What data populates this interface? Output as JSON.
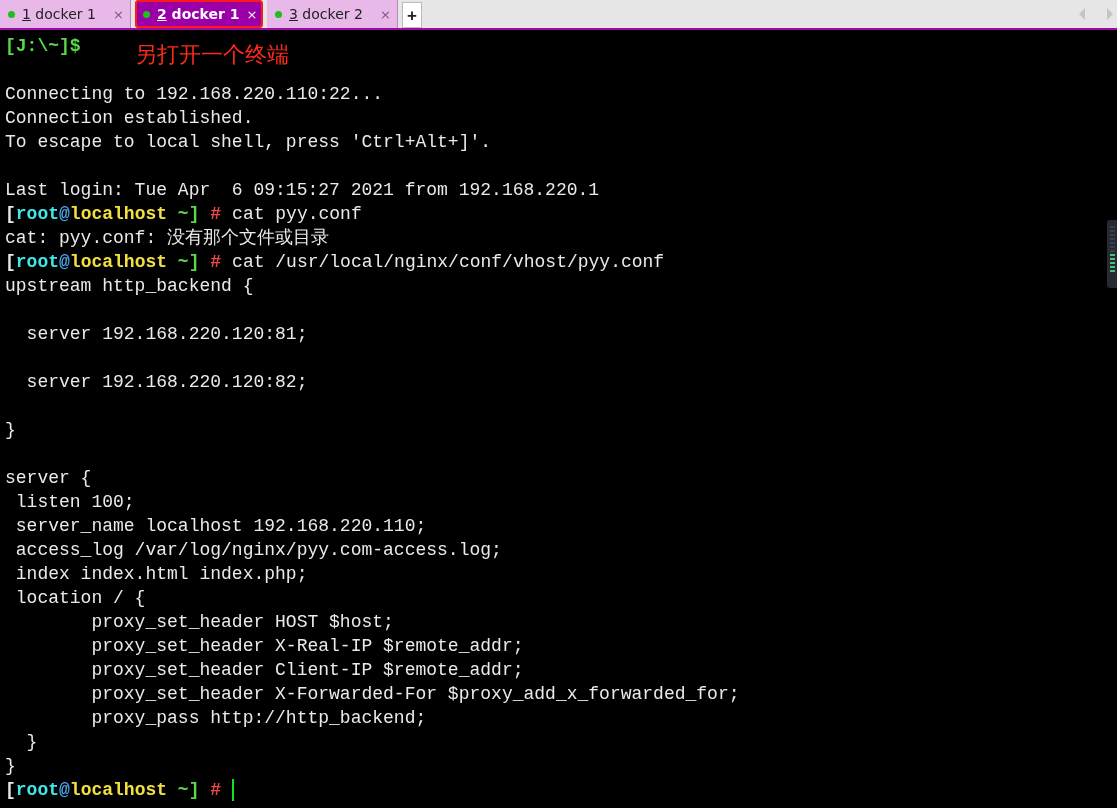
{
  "tabs": [
    {
      "number": "1",
      "label": "docker 1",
      "close": "×",
      "selected": false
    },
    {
      "number": "2",
      "label": "docker 1",
      "close": "×",
      "selected": true
    },
    {
      "number": "3",
      "label": "docker 2",
      "close": "×",
      "selected": false
    }
  ],
  "new_tab": "+",
  "annotation": "另打开一个终端",
  "lines": [
    {
      "kind": "local",
      "text": "[J:\\~]$"
    },
    {
      "kind": "blank"
    },
    {
      "kind": "plain",
      "text": "Connecting to 192.168.220.110:22..."
    },
    {
      "kind": "plain",
      "text": "Connection established."
    },
    {
      "kind": "plain",
      "text": "To escape to local shell, press 'Ctrl+Alt+]'."
    },
    {
      "kind": "blank"
    },
    {
      "kind": "plain",
      "text": "Last login: Tue Apr  6 09:15:27 2021 from 192.168.220.1"
    },
    {
      "kind": "prompt",
      "segments": [
        {
          "text": "[",
          "color": "#e8e8e8"
        },
        {
          "text": "root",
          "color": "#3ee8e8"
        },
        {
          "text": "@",
          "color": "#4aa8f0"
        },
        {
          "text": "localhost",
          "color": "#f0e040"
        },
        {
          "text": " ~]",
          "color": "#5ad84a"
        },
        {
          "text": " #",
          "color": "#f04848"
        }
      ],
      "command": "cat pyy.conf"
    },
    {
      "kind": "plain",
      "text": "cat: pyy.conf: 没有那个文件或目录"
    },
    {
      "kind": "prompt",
      "segments": [
        {
          "text": "[",
          "color": "#e8e8e8"
        },
        {
          "text": "root",
          "color": "#3ee8e8"
        },
        {
          "text": "@",
          "color": "#4aa8f0"
        },
        {
          "text": "localhost",
          "color": "#f0e040"
        },
        {
          "text": " ~]",
          "color": "#5ad84a"
        },
        {
          "text": " #",
          "color": "#f04848"
        }
      ],
      "command": "cat /usr/local/nginx/conf/vhost/pyy.conf"
    },
    {
      "kind": "plain",
      "text": "upstream http_backend {"
    },
    {
      "kind": "blank"
    },
    {
      "kind": "plain",
      "text": "  server 192.168.220.120:81;"
    },
    {
      "kind": "blank"
    },
    {
      "kind": "plain",
      "text": "  server 192.168.220.120:82;"
    },
    {
      "kind": "blank"
    },
    {
      "kind": "plain",
      "text": "}"
    },
    {
      "kind": "blank"
    },
    {
      "kind": "plain",
      "text": "server {"
    },
    {
      "kind": "plain",
      "text": " listen 100;"
    },
    {
      "kind": "plain",
      "text": " server_name localhost 192.168.220.110;"
    },
    {
      "kind": "plain",
      "text": " access_log /var/log/nginx/pyy.com-access.log;"
    },
    {
      "kind": "plain",
      "text": " index index.html index.php;"
    },
    {
      "kind": "plain",
      "text": " location / {"
    },
    {
      "kind": "plain",
      "text": "        proxy_set_header HOST $host;"
    },
    {
      "kind": "plain",
      "text": "        proxy_set_header X-Real-IP $remote_addr;"
    },
    {
      "kind": "plain",
      "text": "        proxy_set_header Client-IP $remote_addr;"
    },
    {
      "kind": "plain",
      "text": "        proxy_set_header X-Forwarded-For $proxy_add_x_forwarded_for;"
    },
    {
      "kind": "plain",
      "text": "        proxy_pass http://http_backend;"
    },
    {
      "kind": "plain",
      "text": "  }"
    },
    {
      "kind": "plain",
      "text": "}"
    },
    {
      "kind": "prompt",
      "segments": [
        {
          "text": "[",
          "color": "#e8e8e8"
        },
        {
          "text": "root",
          "color": "#3ee8e8"
        },
        {
          "text": "@",
          "color": "#4aa8f0"
        },
        {
          "text": "localhost",
          "color": "#f0e040"
        },
        {
          "text": " ~]",
          "color": "#5ad84a"
        },
        {
          "text": " #",
          "color": "#f04848"
        }
      ],
      "cursor": true
    }
  ]
}
